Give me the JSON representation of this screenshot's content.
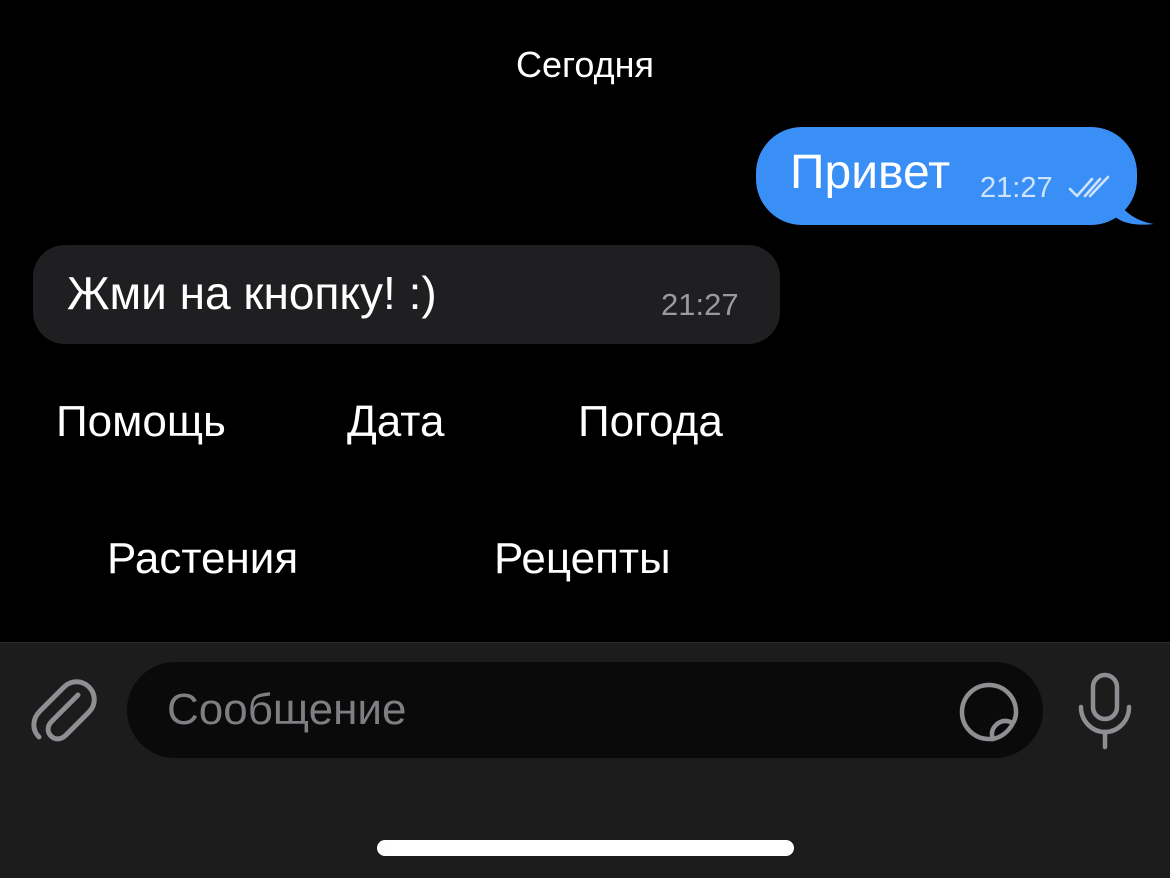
{
  "chat": {
    "date_header": "Сегодня",
    "messages": [
      {
        "direction": "outgoing",
        "text": "Привет",
        "time": "21:27",
        "status": "read",
        "status_icon": "double-check-icon"
      },
      {
        "direction": "incoming",
        "text": "Жми на кнопку! :)",
        "time": "21:27"
      }
    ]
  },
  "keyboard": {
    "rows": [
      [
        "Помощь",
        "Дата",
        "Погода"
      ],
      [
        "Растения",
        "Рецепты"
      ]
    ]
  },
  "input_bar": {
    "placeholder": "Сообщение",
    "value": "",
    "attach_icon": "paperclip-icon",
    "sticker_icon": "sticker-icon",
    "mic_icon": "microphone-icon"
  },
  "colors": {
    "background": "#000000",
    "outgoing_bubble": "#3a8ff7",
    "incoming_bubble": "#1f1f21",
    "input_bar": "#1c1c1d",
    "icon_gray": "#8e8e93"
  }
}
